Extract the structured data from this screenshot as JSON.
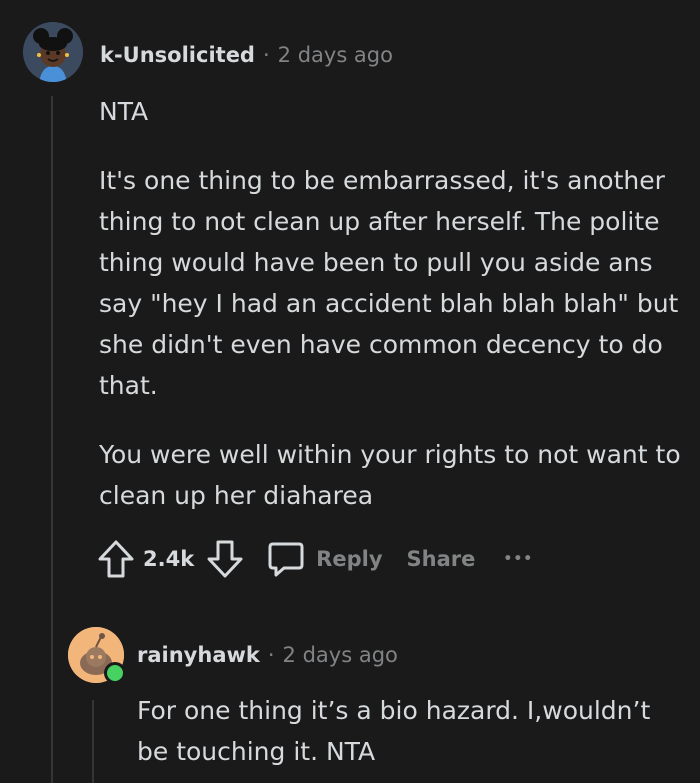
{
  "comment": {
    "username": "k-Unsolicited",
    "separator": "·",
    "timestamp": "2 days ago",
    "paragraphs": [
      "NTA",
      "It's one thing to be embarrassed, it's another thing to not clean up after herself. The polite thing would have been to pull you aside ans say \"hey I had an accident blah blah blah\" but she didn't even have common decency to do that.",
      "You were well within your rights to not want to clean up her diaharea"
    ],
    "actions": {
      "upvote_icon": "upvote-arrow-icon",
      "score": "2.4k",
      "downvote_icon": "downvote-arrow-icon",
      "reply_icon": "speech-bubble-icon",
      "reply_label": "Reply",
      "share_label": "Share",
      "more_label": "•••"
    }
  },
  "reply": {
    "username": "rainyhawk",
    "separator": "·",
    "timestamp": "2 days ago",
    "online_status_color": "#46d160",
    "text": "For one thing it’s a bio hazard. I,wouldn’t be touching it. NTA"
  },
  "colors": {
    "background": "#1a1a1b",
    "text": "#d7dadc",
    "muted": "#818384",
    "thread_line": "#343536",
    "avatar1_bg": "#3c4a5f",
    "avatar2_bg": "#f2b67a"
  }
}
